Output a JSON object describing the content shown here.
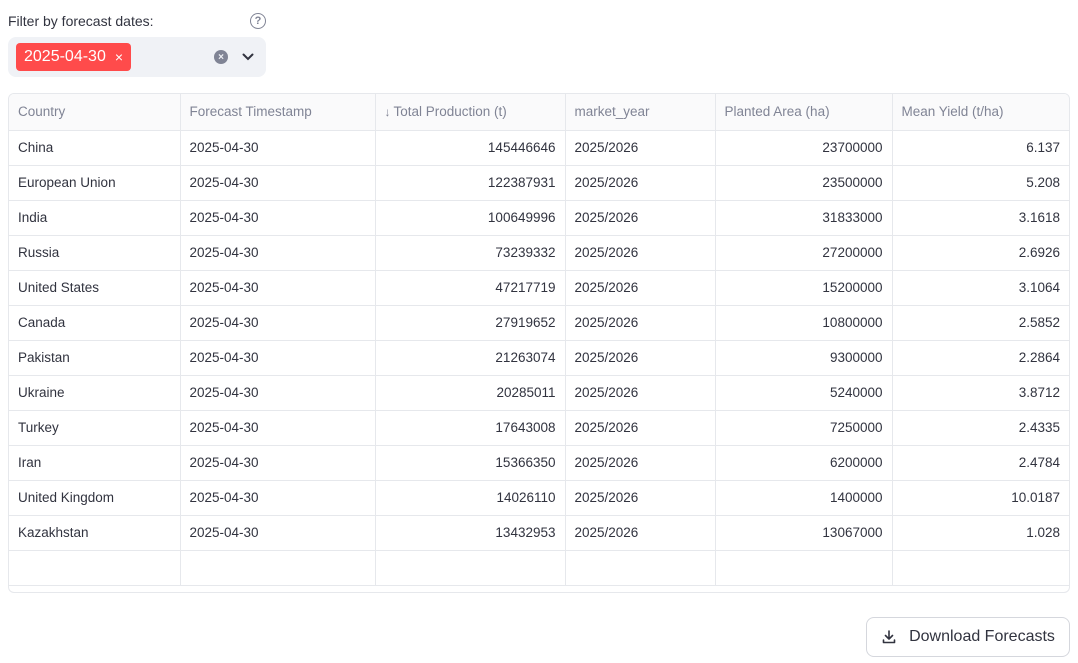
{
  "filter": {
    "label": "Filter by forecast dates:",
    "help_icon": "?",
    "selected": [
      {
        "label": "2025-04-30",
        "remove": "×"
      }
    ],
    "clear_icon": "×",
    "accent_color": "#ff4b4b"
  },
  "table": {
    "sort_arrow": "↓",
    "headers": [
      "Country",
      "Forecast Timestamp",
      "Total Production (t)",
      "market_year",
      "Planted Area (ha)",
      "Mean Yield (t/ha)"
    ],
    "rows": [
      [
        "China",
        "2025-04-30",
        "145446646",
        "2025/2026",
        "23700000",
        "6.137"
      ],
      [
        "European Union",
        "2025-04-30",
        "122387931",
        "2025/2026",
        "23500000",
        "5.208"
      ],
      [
        "India",
        "2025-04-30",
        "100649996",
        "2025/2026",
        "31833000",
        "3.1618"
      ],
      [
        "Russia",
        "2025-04-30",
        "73239332",
        "2025/2026",
        "27200000",
        "2.6926"
      ],
      [
        "United States",
        "2025-04-30",
        "47217719",
        "2025/2026",
        "15200000",
        "3.1064"
      ],
      [
        "Canada",
        "2025-04-30",
        "27919652",
        "2025/2026",
        "10800000",
        "2.5852"
      ],
      [
        "Pakistan",
        "2025-04-30",
        "21263074",
        "2025/2026",
        "9300000",
        "2.2864"
      ],
      [
        "Ukraine",
        "2025-04-30",
        "20285011",
        "2025/2026",
        "5240000",
        "3.8712"
      ],
      [
        "Turkey",
        "2025-04-30",
        "17643008",
        "2025/2026",
        "7250000",
        "2.4335"
      ],
      [
        "Iran",
        "2025-04-30",
        "15366350",
        "2025/2026",
        "6200000",
        "2.4784"
      ],
      [
        "United Kingdom",
        "2025-04-30",
        "14026110",
        "2025/2026",
        "1400000",
        "10.0187"
      ],
      [
        "Kazakhstan",
        "2025-04-30",
        "13432953",
        "2025/2026",
        "13067000",
        "1.028"
      ]
    ]
  },
  "download": {
    "label": "Download Forecasts",
    "icon": "download-icon"
  }
}
